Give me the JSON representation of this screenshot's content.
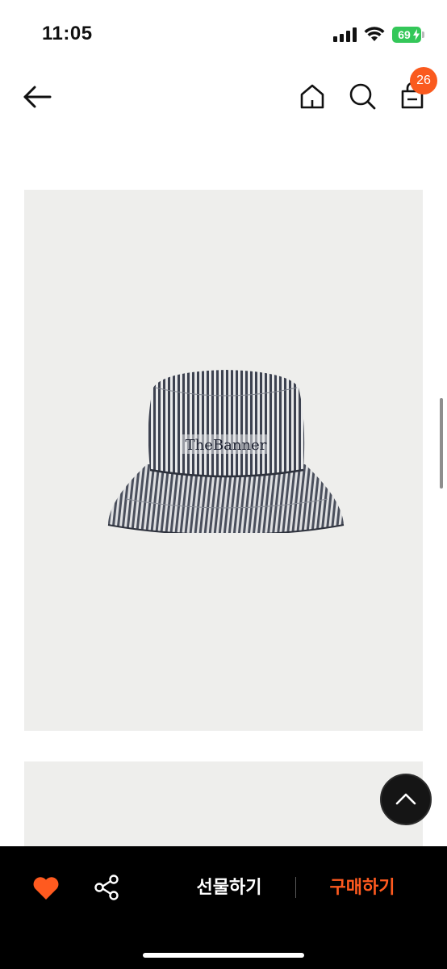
{
  "status_bar": {
    "time": "11:05",
    "battery_level": "69",
    "battery_color": "#34c759"
  },
  "nav": {
    "back_icon": "arrow-left-icon",
    "home_icon": "home-icon",
    "search_icon": "search-icon",
    "cart_icon": "shopping-bag-icon",
    "cart_count": "26",
    "badge_color": "#fa5a1e"
  },
  "product": {
    "images": [
      "bucket-hat-front",
      "product-photo-2"
    ],
    "hat_logo_text": "TheBanner"
  },
  "actions": {
    "like_icon": "heart-icon",
    "like_color": "#ff5a1f",
    "share_icon": "share-icon",
    "gift_label": "선물하기",
    "buy_label": "구매하기",
    "buy_color": "#ff5a1f",
    "scroll_top_icon": "chevron-up-icon"
  }
}
